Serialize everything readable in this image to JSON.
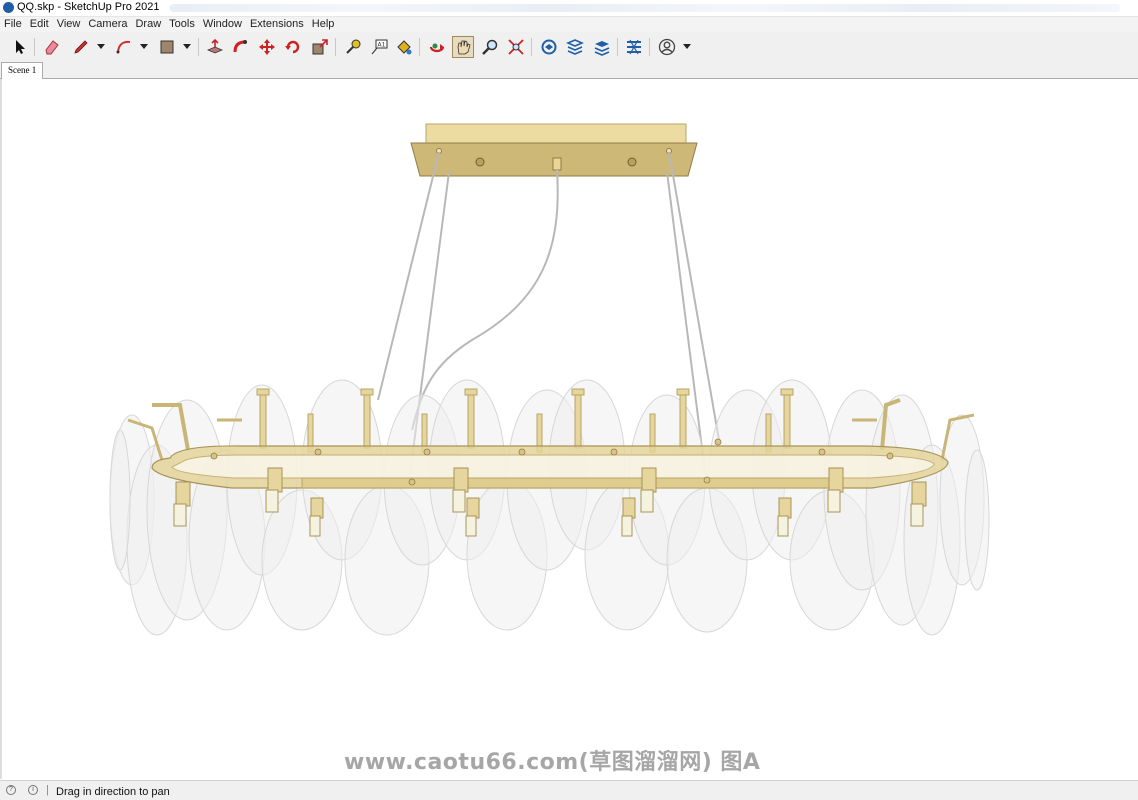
{
  "window": {
    "title": "QQ.skp - SketchUp Pro 2021"
  },
  "menu": [
    "File",
    "Edit",
    "View",
    "Camera",
    "Draw",
    "Tools",
    "Window",
    "Extensions",
    "Help"
  ],
  "toolbar": {
    "tools": [
      "select-icon",
      "eraser-icon",
      "pencil-icon",
      "arc-icon",
      "rectangle-icon",
      "push-pull-icon",
      "follow-me-icon",
      "move-icon",
      "rotate-icon",
      "scale-icon",
      "tape-measure-icon",
      "text-icon",
      "paint-bucket-icon",
      "orbit-icon",
      "pan-icon",
      "zoom-icon",
      "zoom-extents-icon",
      "warehouse-icon",
      "extension-warehouse-icon",
      "layout-icon",
      "extension-manager-icon",
      "profile-icon"
    ],
    "active_tool": "pan-icon"
  },
  "scene_tabs": [
    {
      "label": "Scene 1"
    }
  ],
  "status": {
    "message": "Drag in direction to pan"
  },
  "watermark": "www.caotu66.com(草图溜溜网) 图A",
  "colors": {
    "brass": "#e4d39a",
    "brass_dark": "#a89458",
    "glass": "#e9e9e9",
    "toolbar_bg": "#f0f0f0",
    "accent_blue": "#1e5fa8"
  }
}
